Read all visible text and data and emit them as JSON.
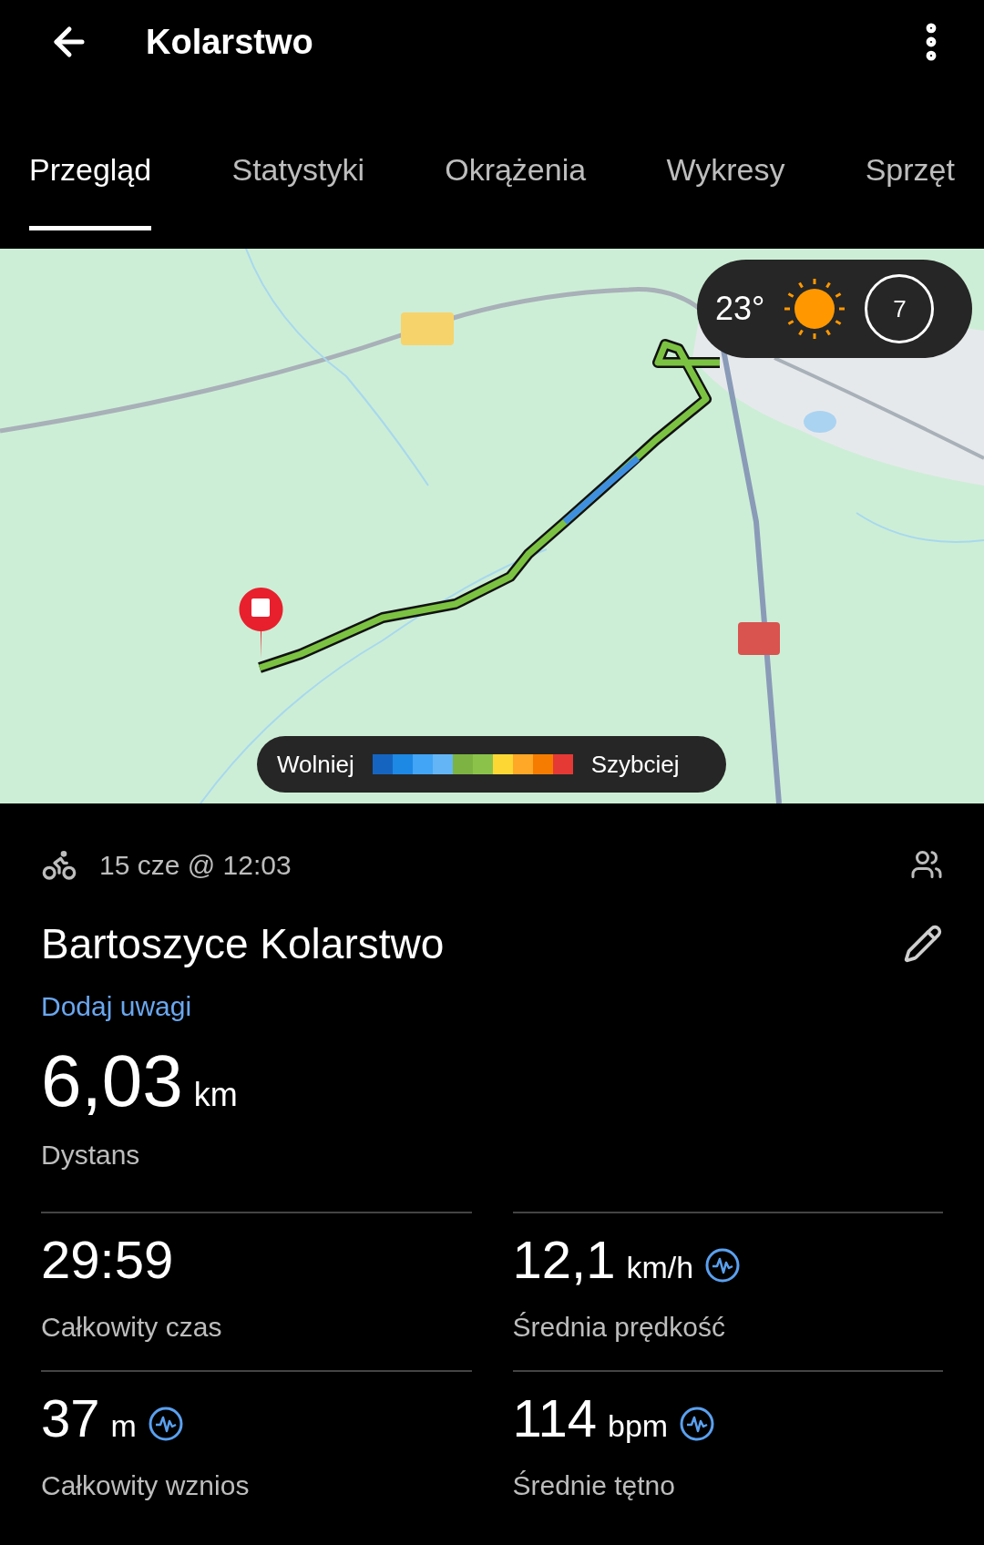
{
  "header": {
    "title": "Kolarstwo"
  },
  "tabs": [
    {
      "label": "Przegląd",
      "selected": true
    },
    {
      "label": "Statystyki",
      "selected": false
    },
    {
      "label": "Okrążenia",
      "selected": false
    },
    {
      "label": "Wykresy",
      "selected": false
    },
    {
      "label": "Sprzęt",
      "selected": false
    }
  ],
  "map": {
    "kind": "picture",
    "weather": {
      "temperature": "23°",
      "wind": "7"
    },
    "legend": {
      "slow_label": "Wolniej",
      "fast_label": "Szybciej",
      "segments": [
        {
          "color": "#1565c0"
        },
        {
          "color": "#1e88e5"
        },
        {
          "color": "#42a5f5"
        },
        {
          "color": "#64b5f6"
        },
        {
          "color": "#7cb342"
        },
        {
          "color": "#8bc34a"
        },
        {
          "color": "#fdd835"
        },
        {
          "color": "#ffa726"
        },
        {
          "color": "#f57c00"
        },
        {
          "color": "#e53935"
        }
      ]
    }
  },
  "activity": {
    "date": "15 cze @ 12:03",
    "title": "Bartoszyce Kolarstwo",
    "notes_link": "Dodaj uwagi"
  },
  "distance": {
    "value": "6,03",
    "unit": "km",
    "label": "Dystans"
  },
  "stats": [
    {
      "value": "29:59",
      "label": "Całkowity czas",
      "has_chart": false
    },
    {
      "value": "12,1",
      "unit": "km/h",
      "label": "Średnia prędkość",
      "has_chart": true
    },
    {
      "value": "37",
      "unit": "m",
      "label": "Całkowity wznios",
      "has_chart": true
    },
    {
      "value": "114",
      "unit": "bpm",
      "label": "Średnie tętno",
      "has_chart": true
    }
  ]
}
